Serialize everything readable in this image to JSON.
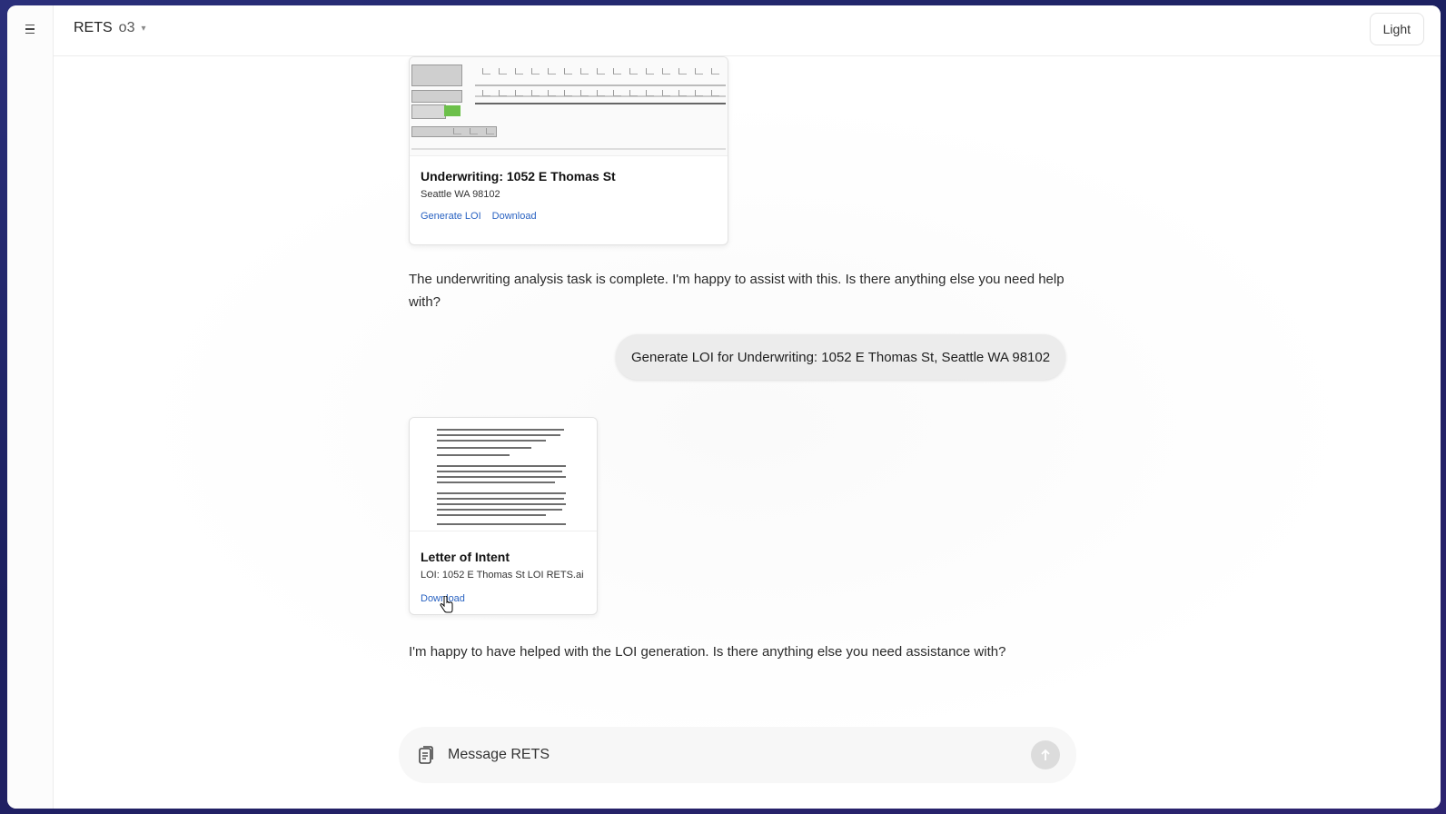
{
  "header": {
    "app_name": "RETS",
    "model": "o3",
    "model_chevron": "▾",
    "theme_label": "Light"
  },
  "messages": {
    "underwriting_card": {
      "title": "Underwriting: 1052 E Thomas St",
      "subtitle": "Seattle WA 98102",
      "generate_label": "Generate LOI",
      "download_label": "Download"
    },
    "assistant_1": "The underwriting analysis task is complete. I'm happy to assist with this. Is there anything else you need help with?",
    "user_1": "Generate LOI for Underwriting: 1052 E Thomas St, Seattle WA 98102",
    "loi_card": {
      "title": "Letter of Intent",
      "subtitle": "LOI: 1052 E Thomas St LOI RETS.ai",
      "download_label": "Download"
    },
    "assistant_2": "I'm happy to have helped with the LOI generation. Is there anything else you need assistance with?"
  },
  "composer": {
    "placeholder": "Message RETS"
  },
  "icons": {
    "menu": "menu-icon",
    "attach": "attach-icon",
    "send": "arrow-up-icon",
    "cursor": "hand-pointer-icon"
  },
  "colors": {
    "link": "#2a63c2",
    "user_bubble": "#ececec",
    "desktop_bg": "#1b1f5e"
  }
}
